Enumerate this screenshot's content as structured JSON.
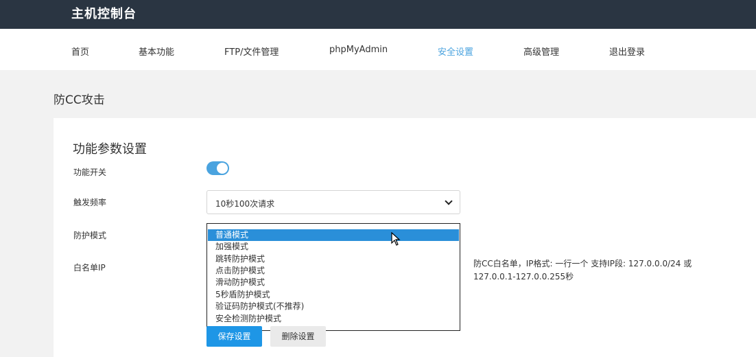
{
  "app": {
    "title": "主机控制台"
  },
  "nav": {
    "items": [
      {
        "label": "首页"
      },
      {
        "label": "基本功能"
      },
      {
        "label": "FTP/文件管理"
      },
      {
        "label": "phpMyAdmin"
      },
      {
        "label": "安全设置",
        "active": true
      },
      {
        "label": "高级管理"
      },
      {
        "label": "退出登录"
      }
    ]
  },
  "page": {
    "title": "防CC攻击"
  },
  "section": {
    "title": "功能参数设置"
  },
  "form": {
    "switch_label": "功能开关",
    "switch_on": true,
    "frequency_label": "触发频率",
    "frequency_value": "10秒100次请求",
    "mode_label": "防护模式",
    "mode_options": [
      "普通模式",
      "加强模式",
      "跳转防护模式",
      "点击防护模式",
      "滑动防护模式",
      "5秒盾防护模式",
      "验证码防护模式(不推荐)",
      "安全检测防护模式"
    ],
    "mode_selected": "普通模式",
    "whitelist_label": "白名单IP",
    "whitelist_help_line1": "防CC白名单，IP格式: 一行一个 支持IP段: 127.0.0.0/24 或",
    "whitelist_help_line2": "127.0.0.1-127.0.0.255秒"
  },
  "buttons": {
    "save": "保存设置",
    "delete": "删除设置"
  },
  "colors": {
    "header_bg": "#2a3542",
    "accent": "#4aa3df",
    "selected_bg": "#2a8fd9",
    "primary_button": "#1e96e6"
  }
}
